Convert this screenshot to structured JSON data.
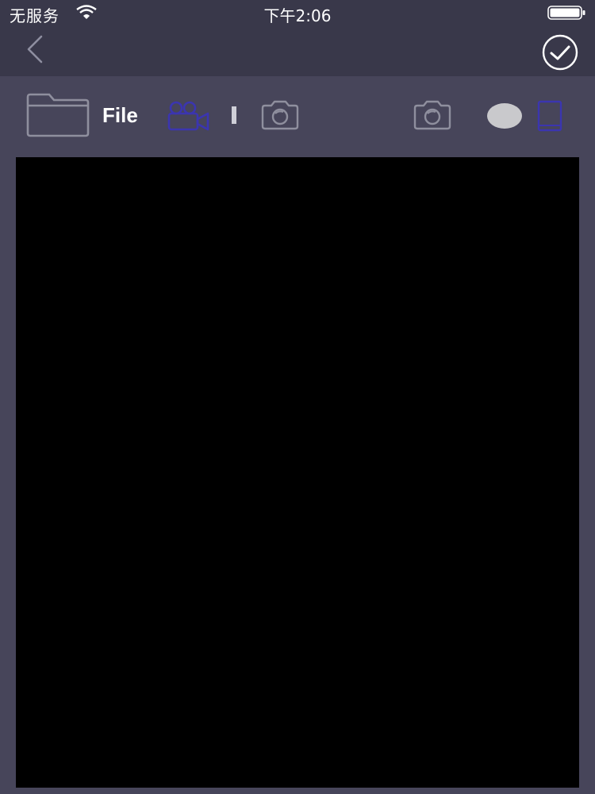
{
  "status_bar": {
    "carrier": "无服务",
    "time": "下午2:06",
    "wifi_icon": "wifi-icon",
    "battery_icon": "battery-icon"
  },
  "nav_bar": {
    "back_icon": "chevron-left-icon",
    "done_icon": "checkmark-circle-icon"
  },
  "toolbar": {
    "file_label": "File",
    "folder_icon": "folder-icon",
    "video_icon": "video-camera-icon",
    "camera_icon": "camera-icon",
    "record_icon": "record-circle-icon",
    "device_icon": "tablet-icon"
  },
  "colors": {
    "background": "#47455a",
    "bar_background": "#39384a",
    "accent": "#3b35b0",
    "preview": "#000000"
  }
}
